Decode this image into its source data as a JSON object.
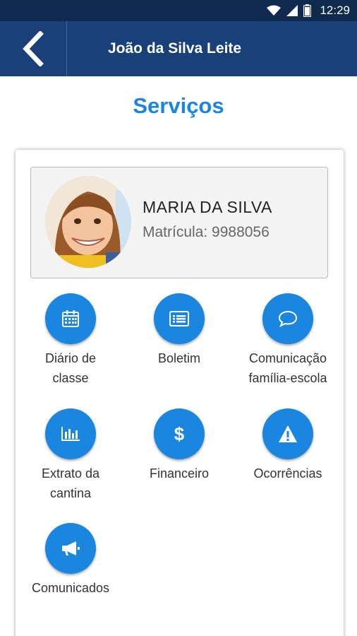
{
  "status_bar": {
    "time": "12:29"
  },
  "app_bar": {
    "title": "João da Silva Leite",
    "back_icon": "chevron-left-icon"
  },
  "page": {
    "title": "Serviços"
  },
  "student": {
    "name": "MARIA DA SILVA",
    "registration": "Matrícula: 9988056"
  },
  "services": [
    {
      "label": "Diário de classe",
      "icon": "calendar-icon"
    },
    {
      "label": "Boletim",
      "icon": "report-card-icon"
    },
    {
      "label": "Comunicação família-escola",
      "icon": "chat-bubble-icon"
    },
    {
      "label": "Extrato da cantina",
      "icon": "bar-chart-icon"
    },
    {
      "label": "Financeiro",
      "icon": "dollar-icon"
    },
    {
      "label": "Ocorrências",
      "icon": "warning-icon"
    },
    {
      "label": "Comunicados",
      "icon": "megaphone-icon"
    }
  ],
  "colors": {
    "status_bar": "#0f2a4e",
    "app_bar": "#1a4079",
    "accent": "#1a86e0"
  }
}
